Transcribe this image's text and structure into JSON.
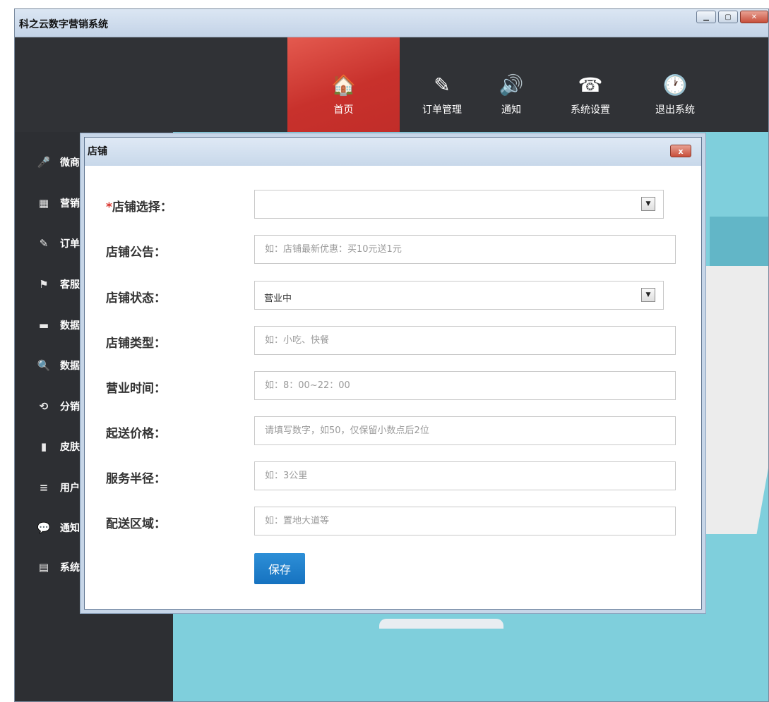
{
  "window": {
    "title": "科之云数字营销系统"
  },
  "nav": [
    {
      "label": "首页",
      "icon": "home-icon",
      "glyph": "🏠"
    },
    {
      "label": "订单管理",
      "icon": "edit-icon",
      "glyph": "✎"
    },
    {
      "label": "通知",
      "icon": "speaker-icon",
      "glyph": "🔊"
    },
    {
      "label": "系统设置",
      "icon": "phone-icon",
      "glyph": "☎"
    },
    {
      "label": "退出系统",
      "icon": "clock-icon",
      "glyph": "🕐"
    }
  ],
  "sidebar": [
    {
      "label": "微商",
      "glyph": "🎤"
    },
    {
      "label": "营销",
      "glyph": "▦"
    },
    {
      "label": "订单",
      "glyph": "✎"
    },
    {
      "label": "客服",
      "glyph": "⚑"
    },
    {
      "label": "数据",
      "glyph": "▬"
    },
    {
      "label": "数据",
      "glyph": "🔍"
    },
    {
      "label": "分销",
      "glyph": "⟲"
    },
    {
      "label": "皮肤",
      "glyph": "▮"
    },
    {
      "label": "用户",
      "glyph": "≡"
    },
    {
      "label": "通知",
      "glyph": "💬"
    },
    {
      "label": "系统",
      "glyph": "▤"
    }
  ],
  "dialog": {
    "title": "店铺",
    "close_label": "x",
    "fields": {
      "shop_select": {
        "required_mark": "*",
        "label": "店铺选择：",
        "value": ""
      },
      "notice": {
        "label": "店铺公告：",
        "placeholder": "如：店铺最新优惠：买10元送1元"
      },
      "status": {
        "label": "店铺状态：",
        "value": "营业中"
      },
      "type": {
        "label": "店铺类型：",
        "placeholder": "如：小吃、快餐"
      },
      "hours": {
        "label": "营业时间：",
        "placeholder": "如：8：00~22：00"
      },
      "min_price": {
        "label": "起送价格：",
        "placeholder": "请填写数字，如50，仅保留小数点后2位"
      },
      "radius": {
        "label": "服务半径：",
        "placeholder": "如：3公里"
      },
      "area": {
        "label": "配送区域：",
        "placeholder": "如：置地大道等"
      }
    },
    "save_label": "保存"
  },
  "colors": {
    "accent": "#c8312c",
    "primary_button": "#1d7bc9",
    "content_bg": "#7fcfdc"
  }
}
